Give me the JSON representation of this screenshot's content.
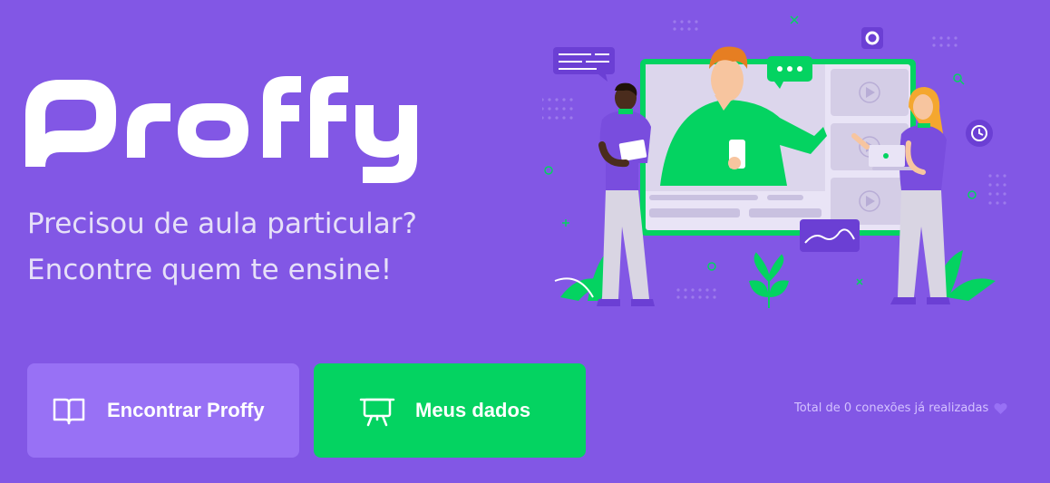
{
  "brand": {
    "name": "Proffy"
  },
  "tagline": {
    "line1": "Precisou de aula particular?",
    "line2": "Encontre quem te ensine!"
  },
  "buttons": {
    "study_label": "Encontrar Proffy",
    "study_icon": "open-book-icon",
    "give_label": "Meus dados",
    "give_icon": "presentation-board-icon"
  },
  "footer": {
    "total_connections": "Total de 0 conexões já realizadas",
    "heart_icon": "heart-icon"
  },
  "colors": {
    "background": "#8257E5",
    "button_primary": "#9871F5",
    "button_secondary": "#04D361",
    "text_light": "#E6E0F8",
    "text_muted": "#D4C2FF"
  }
}
